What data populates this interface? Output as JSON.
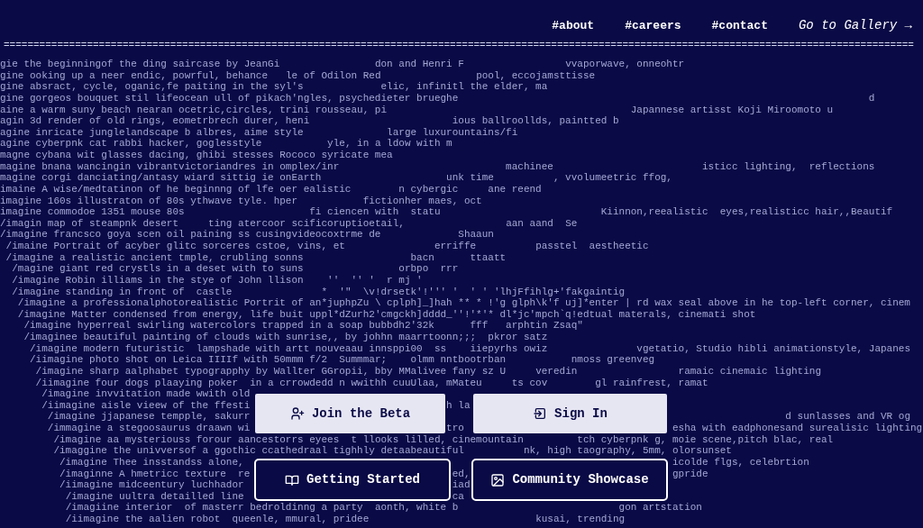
{
  "nav_links": [
    "#about",
    "#careers",
    "#contact"
  ],
  "gallery_link": "Go to Gallery →",
  "divider": "=========================================================================================================================================================",
  "prompt_lines": [
    [
      "gie the beginningof the ding saircase by JeanGi",
      "                don and Henri F",
      "                 vvaporwave, onneohtr"
    ],
    [
      "gine ooking up a neer endic, powrful, behance",
      "   le of Odilon Red",
      "                pool, eccojamsttisse"
    ],
    [
      "gine absract, cycle, oganic,fe paiting in the syl's",
      "             elic, infinitl the elder, ma"
    ],
    [
      "gine gorgeos bouquet stil lifeocean ull of pikach'ngles, psychedieter brueghe",
      "                                                                     d"
    ],
    [
      "aine a warm suny beach nearan ocetric,circles, trini rousseau, pi",
      "                                         Japannese artisst Koji Miroomoto u"
    ],
    [
      "agin 3d render of old rings, eometrbrech durer, heni",
      "                        ious ballroollds, paintted b"
    ],
    [
      "agine inricate junglelandscape b albres, aime style",
      "              large luxurountains/fi"
    ],
    [
      "agine cyberpnk cat rabbi hacker, goglesstyle",
      "           yle, in a ldow with m"
    ],
    [
      "magne cybana wit glasses dacing, ghibi stesses Rococo syricate mea"
    ],
    [
      "magine bnana wancingin vibrantvictoriandres in omplex/inr",
      "                            machinee",
      "                         isticc lighting,  reflections"
    ],
    [
      "magine corgi danciating/antasy wiard sittig ie onEarth",
      "                     unk time",
      "          , vvolumeetric ffog,"
    ],
    [
      "imaine A wise/medtatinon of he beginnng of lfe oer ealistic",
      "        n cybergic",
      "     ane reend"
    ],
    [
      "imagine 160s illustraton of 80s ythwave tyle. hper",
      "           fictionher maes, oct"
    ],
    [
      "imagine commodoe 1351 mouse 80s",
      "                     fi ciencen with  statu",
      "                           Kiinnon,reealistic  eyes,realisticc hair,,Beautif"
    ],
    [
      "/imagin map of steampnk desert",
      "     ting atercoor scificoruptioetail,",
      "                 aan aand  Se"
    ],
    [
      "/imagine francsco goya scen oil paining ss cusingvideocoxtrme de",
      "             Shaaun"
    ],
    [
      " /imaine Portrait of acyber glitc sorceres cstoe, vins, et",
      "               erriffe",
      "          passtel  aestheetic"
    ],
    [
      " /imagine a realistic ancient tmple, crubling sonns",
      "                  bacn",
      "      ttaatt"
    ],
    [
      "  /magine giant red crystls in a deset with to suns",
      "                orbpo  rrr"
    ],
    [
      "  /imagine Robin illiams in the stye of John llison",
      "    ''  '' '  r mj '"
    ],
    [
      "  /imagine standing in front of  castle",
      "               *  '\"  \\v!drsetk'!''' '  ' ' 'lhjFfihlg+'fakgaintig"
    ],
    [
      "   /imagine a professionalphotorealistic Portrit of an*juphpZu \\ cplph]_]hah ** * !'g glph\\k'f uj]*enter | rd wax seal above in he top-left corner, cinem"
    ],
    [
      "   /imagine Matter condensed from energy, life buit uppl*dZurh2'cmgckh]dddd_''!'*'* dl*jc'mpch`q!edtual materals, cinemati shot"
    ],
    [
      "    /imagine hyperreal swirling watercolors trapped in a soap bubbdh2'32k",
      "      fff   arphtin Zsaq\""
    ],
    [
      "    /imaginee beautiful painting of clouds with sunrise,, by johhn maarrtoonn;;;  pkror satz"
    ],
    [
      "     /imagine modern futuristic  lampshade with artt nouveaau innsppi00  ss    iiepyrhs owiz",
      "               vgetatio, Studio hibli animationstyle, Japanes"
    ],
    [
      "     /iimagine photo shot on Leica IIIIf with 50mmm f/2  Summmar;",
      "    olmm nntbootrban",
      "           nmoss greenveg"
    ],
    [
      "      /imagine sharp aalphabet typograpphy by Wallter GGropii, bby MMalivee fany sz U",
      "     veredin",
      "                 ramaic cinemaic lighting"
    ],
    [
      "      /iimagine four dogs plaaying poker  in a crrowdedd n wwithh cuuUlaa, mMateu",
      "     ts cov",
      "        gl rainfrest, ramat"
    ],
    [
      "       /imagine invvitation made wwith old"
    ],
    [
      "       /iimagine aisle vieew of the ffesti",
      "                                 h la"
    ],
    [
      "        /imagine jjapanese tempple, sakurr",
      "                                                                                          d sunlasses and VR og"
    ],
    [
      "        /immagine a stegoosaurus draawn wi",
      "                                 tro",
      "                                   esha with eadphonesand surealisic lighting"
    ],
    [
      "         /imagine aa mysteriouss forour aancestorrs eyees  t llooks lilled, cinemountain",
      "         tch cyberpnk g, moie scene,pitch blac, real"
    ],
    [
      "         /imaggine the univversof a ggothic ccathedraal tighhly detaabeautiful",
      "          nk, high taography, 5mm, olorsunset"
    ],
    [
      "          /imagine Thee insstandss alone,",
      "                                                                        icolde flgs, celebrtion"
    ],
    [
      "          /imaginne A hmetricc texture  re",
      "                                  ed,",
      "                                  gpride"
    ],
    [
      "          /iimagine midceentury luchhador",
      "                                   iad"
    ],
    [
      "           /imagine uultra detailled line",
      "                                   ca"
    ],
    [
      "           /imagiine interior  of masterr bedroldinng a party  aonth, white b",
      "                           gon artstation"
    ],
    [
      "           /iimagine the aalien robot  queenle, mmural, pridee",
      "                            kusai, trending"
    ]
  ],
  "buttons": [
    {
      "label": "Join the Beta",
      "kind": "filled"
    },
    {
      "label": "Sign In",
      "kind": "filled"
    },
    {
      "label": "Getting Started",
      "kind": "outlined"
    },
    {
      "label": "Community Showcase",
      "kind": "outlined"
    }
  ]
}
